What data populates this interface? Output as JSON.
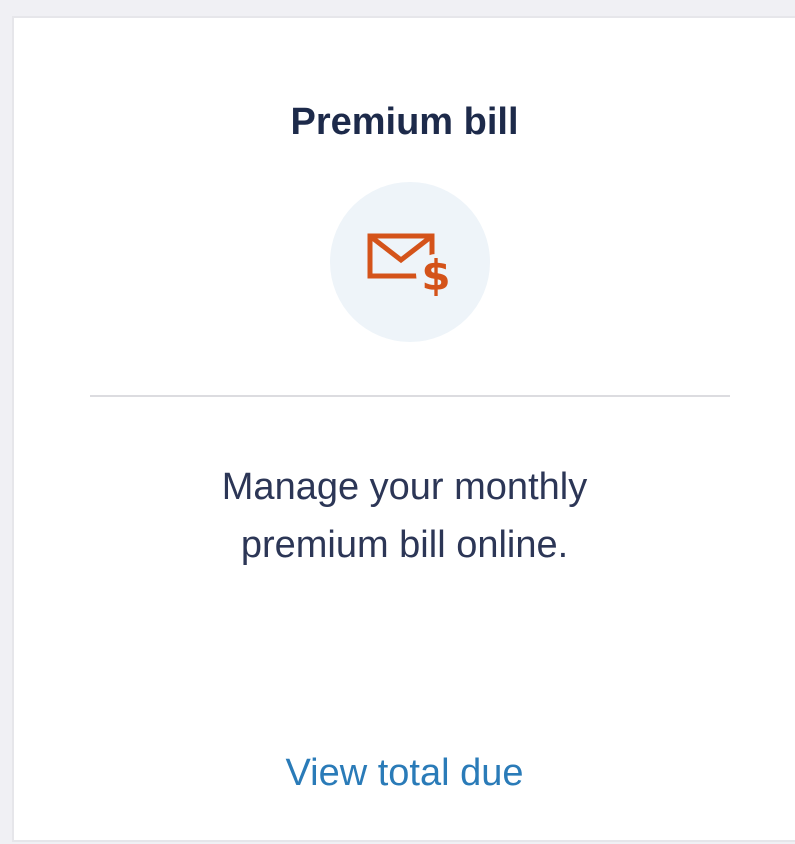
{
  "card": {
    "title": "Premium bill",
    "icon": "envelope-dollar-icon",
    "description_line1": "Manage your monthly",
    "description_line2": "premium bill online.",
    "link_label": "View total due"
  },
  "colors": {
    "title": "#1d2a4a",
    "text": "#2c3656",
    "link": "#2a7bb8",
    "icon": "#d4531a",
    "icon_bg": "#eef4f9"
  }
}
